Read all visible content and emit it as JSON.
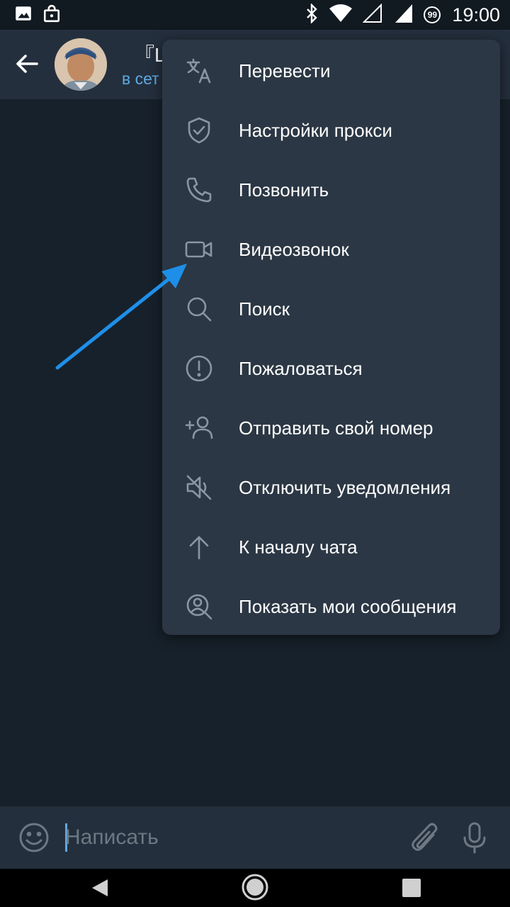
{
  "status_bar": {
    "time": "19:00",
    "badge": "99",
    "icons": [
      "image-icon",
      "shopping-bag-icon",
      "bluetooth-icon",
      "wifi-icon",
      "signal-icon",
      "battery-icon"
    ]
  },
  "header": {
    "title": "『Li",
    "status": "в сет"
  },
  "menu": {
    "items": [
      {
        "label": "Перевести",
        "icon": "translate-icon"
      },
      {
        "label": "Настройки прокси",
        "icon": "shield-icon"
      },
      {
        "label": "Позвонить",
        "icon": "phone-icon"
      },
      {
        "label": "Видеозвонок",
        "icon": "video-camera-icon"
      },
      {
        "label": "Поиск",
        "icon": "search-icon"
      },
      {
        "label": "Пожаловаться",
        "icon": "report-icon"
      },
      {
        "label": "Отправить свой номер",
        "icon": "add-contact-icon"
      },
      {
        "label": "Отключить уведомления",
        "icon": "mute-icon"
      },
      {
        "label": "К началу чата",
        "icon": "arrow-up-icon"
      },
      {
        "label": "Показать мои сообщения",
        "icon": "user-search-icon"
      }
    ]
  },
  "composer": {
    "placeholder": "Написать"
  },
  "colors": {
    "background": "#17212b",
    "header": "#242f3d",
    "menu": "#2b3744",
    "accent": "#5ea9e0",
    "annotation_arrow": "#1e8fe8"
  }
}
